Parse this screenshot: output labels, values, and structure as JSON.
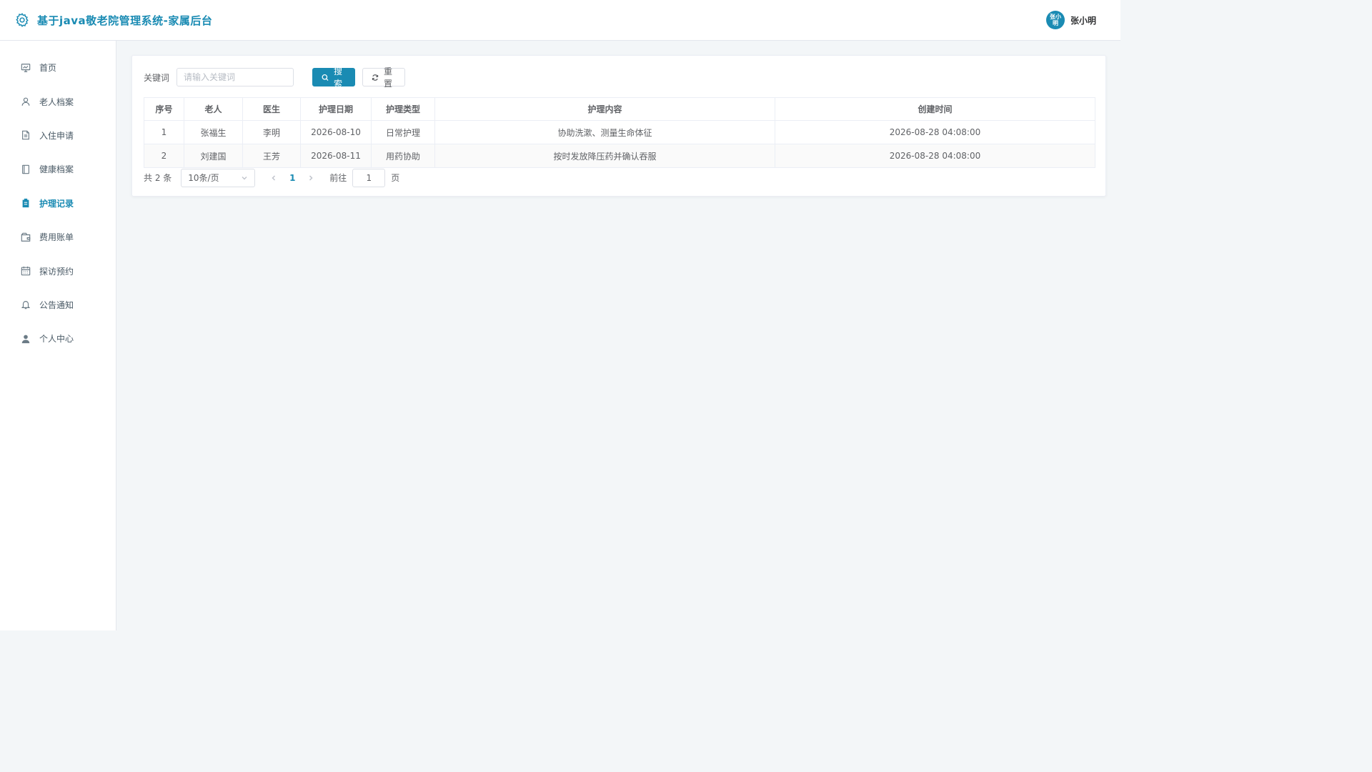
{
  "header": {
    "title": "基于java敬老院管理系统-家属后台",
    "logo_icon": "gear-icon",
    "avatar_text": "张小明",
    "username": "张小明"
  },
  "sidebar": {
    "items": [
      {
        "label": "首页",
        "icon": "dashboard-icon"
      },
      {
        "label": "老人档案",
        "icon": "user-icon"
      },
      {
        "label": "入住申请",
        "icon": "document-icon"
      },
      {
        "label": "健康档案",
        "icon": "notebook-icon"
      },
      {
        "label": "护理记录",
        "icon": "clipboard-icon",
        "active": true
      },
      {
        "label": "费用账单",
        "icon": "wallet-icon"
      },
      {
        "label": "探访预约",
        "icon": "calendar-icon"
      },
      {
        "label": "公告通知",
        "icon": "bell-icon"
      },
      {
        "label": "个人中心",
        "icon": "person-icon"
      }
    ]
  },
  "search": {
    "label": "关键词",
    "placeholder": "请输入关键词",
    "search_button": "搜索",
    "reset_button": "重置"
  },
  "table": {
    "columns": [
      "序号",
      "老人",
      "医生",
      "护理日期",
      "护理类型",
      "护理内容",
      "创建时间"
    ],
    "rows": [
      [
        "1",
        "张福生",
        "李明",
        "2026-08-10",
        "日常护理",
        "协助洗漱、测量生命体征",
        "2026-08-28 04:08:00"
      ],
      [
        "2",
        "刘建国",
        "王芳",
        "2026-08-11",
        "用药协助",
        "按时发放降压药并确认吞服",
        "2026-08-28 04:08:00"
      ]
    ]
  },
  "pagination": {
    "total_text": "共 2 条",
    "page_size": "10条/页",
    "current_page": "1",
    "goto_label": "前往",
    "goto_value": "1",
    "page_unit": "页"
  },
  "colors": {
    "accent": "#1a8bb3",
    "background": "#f3f6f8"
  }
}
